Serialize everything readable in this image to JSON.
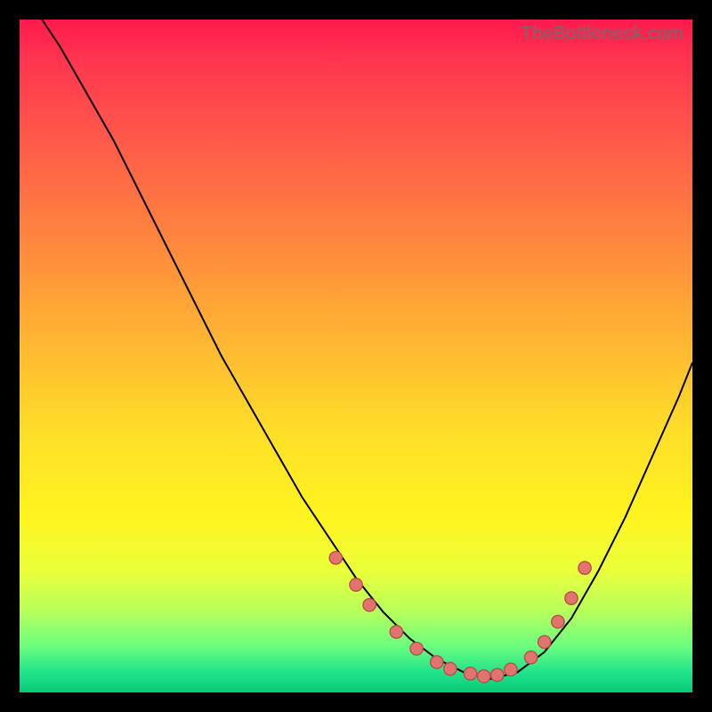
{
  "watermark": "TheBottleneck.com",
  "colors": {
    "background": "#000000",
    "curve": "#000000",
    "point_fill": "#e2746f",
    "point_stroke": "#b94d4a"
  },
  "chart_data": {
    "type": "line",
    "title": "",
    "xlabel": "",
    "ylabel": "",
    "xlim": [
      0,
      100
    ],
    "ylim": [
      0,
      100
    ],
    "curve": {
      "x": [
        2,
        6,
        10,
        14,
        18,
        22,
        26,
        30,
        34,
        38,
        42,
        46,
        50,
        54,
        58,
        62,
        66,
        70,
        74,
        78,
        82,
        86,
        90,
        94,
        98,
        100
      ],
      "y": [
        102,
        96,
        89,
        82,
        74,
        66,
        58,
        50,
        43,
        36,
        29,
        23,
        17,
        12,
        8,
        5,
        3,
        2,
        3,
        6,
        11,
        18,
        26,
        35,
        44,
        49
      ]
    },
    "points": {
      "x": [
        47,
        50,
        52,
        56,
        59,
        62,
        64,
        67,
        69,
        71,
        73,
        76,
        78,
        80,
        82,
        84
      ],
      "y": [
        20,
        16,
        13,
        9,
        6.5,
        4.5,
        3.5,
        2.8,
        2.4,
        2.6,
        3.4,
        5.2,
        7.5,
        10.5,
        14,
        18.5
      ]
    }
  }
}
